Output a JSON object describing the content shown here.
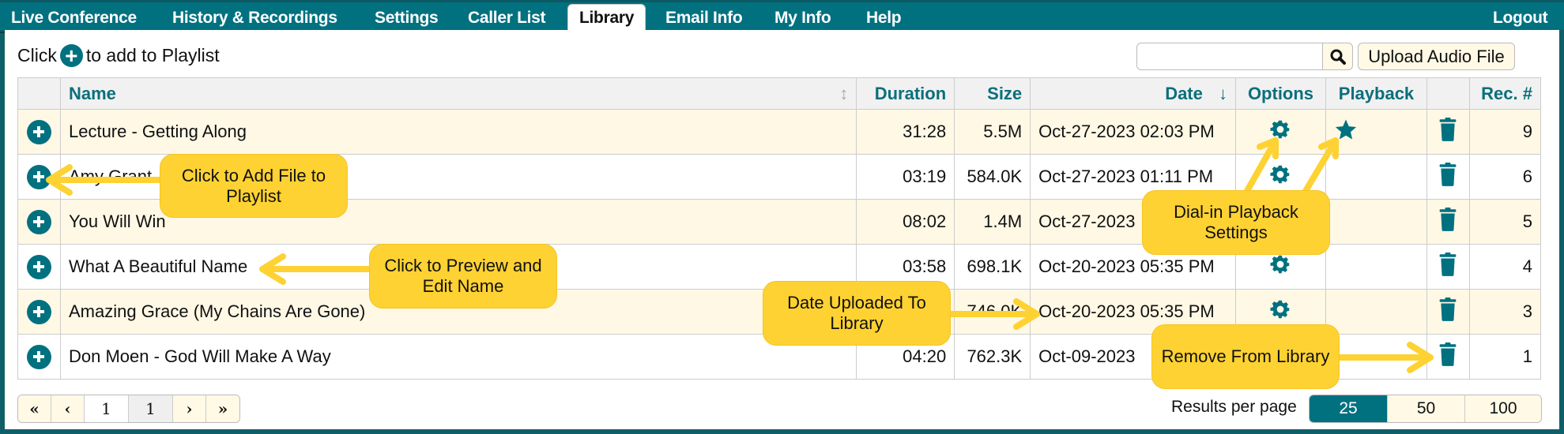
{
  "nav": {
    "tabs": [
      {
        "label": "Live Conference"
      },
      {
        "label": "History & Recordings"
      },
      {
        "label": "Settings"
      },
      {
        "label": "Caller List"
      },
      {
        "label": "Library",
        "active": true
      },
      {
        "label": "Email Info"
      },
      {
        "label": "My Info"
      },
      {
        "label": "Help"
      }
    ],
    "logout": "Logout"
  },
  "toolbar": {
    "hint_before": "Click",
    "hint_after": "to add to Playlist",
    "search_value": "",
    "search_placeholder": "",
    "upload_label": "Upload Audio File"
  },
  "table": {
    "columns": [
      "",
      "Name",
      "Duration",
      "Size",
      "Date",
      "Options",
      "Playback",
      "",
      "Rec. #"
    ],
    "sort_column": "Date",
    "rows": [
      {
        "name": "Lecture - Getting Along",
        "duration": "31:28",
        "size": "5.5M",
        "date": "Oct-27-2023 02:03 PM",
        "playback_star": true,
        "rec": "9"
      },
      {
        "name": "Amy Grant",
        "duration": "03:19",
        "size": "584.0K",
        "date": "Oct-27-2023 01:11 PM",
        "playback_star": false,
        "rec": "6"
      },
      {
        "name": "You Will Win",
        "duration": "08:02",
        "size": "1.4M",
        "date": "Oct-27-2023",
        "playback_star": false,
        "rec": "5"
      },
      {
        "name": "What A Beautiful Name",
        "duration": "03:58",
        "size": "698.1K",
        "date": "Oct-20-2023 05:35 PM",
        "playback_star": false,
        "rec": "4"
      },
      {
        "name": "Amazing Grace (My Chains Are Gone)",
        "duration": "",
        "size": "746.0K",
        "date": "Oct-20-2023 05:35 PM",
        "playback_star": false,
        "rec": "3"
      },
      {
        "name": "Don Moen - God Will Make A Way",
        "duration": "04:20",
        "size": "762.3K",
        "date": "Oct-09-2023",
        "playback_star": false,
        "rec": "1"
      }
    ]
  },
  "pager": {
    "first": "«",
    "prev": "‹",
    "current": "1",
    "total": "1",
    "next": "›",
    "last": "»"
  },
  "results_per_page": {
    "label": "Results per page",
    "options": [
      "25",
      "50",
      "100"
    ],
    "selected": "25"
  },
  "callouts": {
    "add_file": "Click to Add File to Playlist",
    "preview": "Click to Preview and Edit Name",
    "dial_in": "Dial-in Playback Settings",
    "date_uploaded": "Date Uploaded To Library",
    "remove": "Remove From Library"
  },
  "colors": {
    "accent": "#017180",
    "callout": "#fdd232",
    "row_alt": "#fff8e5"
  }
}
